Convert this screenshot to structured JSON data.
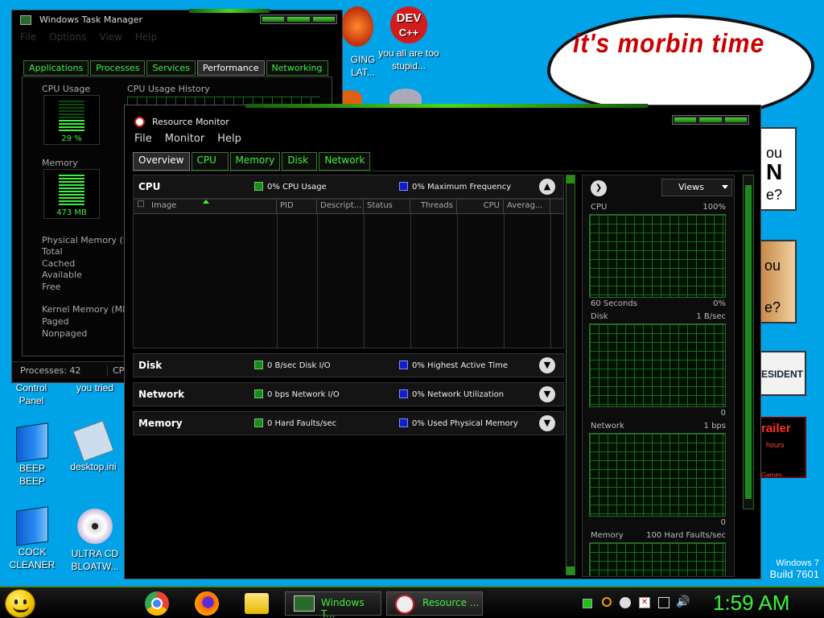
{
  "desktop": {
    "bubble_text": "it's morbin time",
    "icons": {
      "dev": {
        "badge": "DEV",
        "badge2": "C++",
        "label": "you all are too stupid..."
      },
      "ging": {
        "label": "GING LAT..."
      },
      "control_panel": {
        "label": "Control Panel"
      },
      "you_tried": {
        "label": "you tried"
      },
      "beep": {
        "label": "BEEP BEEP"
      },
      "desktop_ini": {
        "label": "desktop.ini"
      },
      "cock_cleaner": {
        "label": "COCK CLEANER"
      },
      "ultra_cd": {
        "label": "ULTRA CD BLOATW..."
      }
    },
    "partial": {
      "t1a": "ou",
      "t1b": "N",
      "t1c": "e?",
      "t2a": "ou",
      "t2b": "e?",
      "t3": "ESIDENT",
      "t4a": "railer",
      "t4b": "hours",
      "t4c": "Games"
    },
    "watermark": {
      "line1": "Windows 7",
      "line2": "Build 7601"
    }
  },
  "task_manager": {
    "title": "Windows Task Manager",
    "menu": [
      "File",
      "Options",
      "View",
      "Help"
    ],
    "tabs": [
      "Applications",
      "Processes",
      "Services",
      "Performance",
      "Networking"
    ],
    "active_tab": "Performance",
    "cpu_usage_label": "CPU Usage",
    "cpu_history_label": "CPU Usage History",
    "cpu_value": "29 %",
    "memory_label": "Memory",
    "memory_value": "473 MB",
    "physical_memory_label": "Physical Memory (MB",
    "physical_rows": [
      "Total",
      "Cached",
      "Available",
      "Free"
    ],
    "kernel_memory_label": "Kernel Memory (MB)",
    "kernel_rows": [
      "Paged",
      "Nonpaged"
    ],
    "status_processes": "Processes: 42",
    "status_cpu": "CPU"
  },
  "resource_monitor": {
    "title": "Resource Monitor",
    "menu": [
      "File",
      "Monitor",
      "Help"
    ],
    "tabs": [
      "Overview",
      "CPU",
      "Memory",
      "Disk",
      "Network"
    ],
    "active_tab": "Overview",
    "cpu_section": {
      "name": "CPU",
      "legend1": "0% CPU Usage",
      "legend2": "0% Maximum Frequency",
      "columns": [
        "Image",
        "PID",
        "Descript...",
        "Status",
        "Threads",
        "CPU",
        "Averag..."
      ]
    },
    "disk_section": {
      "name": "Disk",
      "legend1": "0 B/sec Disk I/O",
      "legend2": "0% Highest Active Time"
    },
    "network_section": {
      "name": "Network",
      "legend1": "0 bps Network I/O",
      "legend2": "0% Network Utilization"
    },
    "memory_section": {
      "name": "Memory",
      "legend1": "0 Hard Faults/sec",
      "legend2": "0% Used Physical Memory"
    },
    "views_label": "Views",
    "graphs": {
      "cpu": {
        "name": "CPU",
        "max": "100%",
        "footer_left": "60 Seconds",
        "footer_right": "0%"
      },
      "disk": {
        "name": "Disk",
        "max": "1 B/sec",
        "footer_right": "0"
      },
      "network": {
        "name": "Network",
        "max": "1 bps",
        "footer_right": "0"
      },
      "memory": {
        "name": "Memory",
        "max": "100 Hard Faults/sec"
      }
    }
  },
  "taskbar": {
    "apps": [
      {
        "label": "Windows T..."
      },
      {
        "label": "Resource ..."
      }
    ],
    "clock": "1:59 AM"
  },
  "colors": {
    "accent_green": "#3cf03c",
    "desktop_blue": "#00a2e8",
    "legend_blue": "#1020c8",
    "legend_green": "#1b8a1b"
  }
}
